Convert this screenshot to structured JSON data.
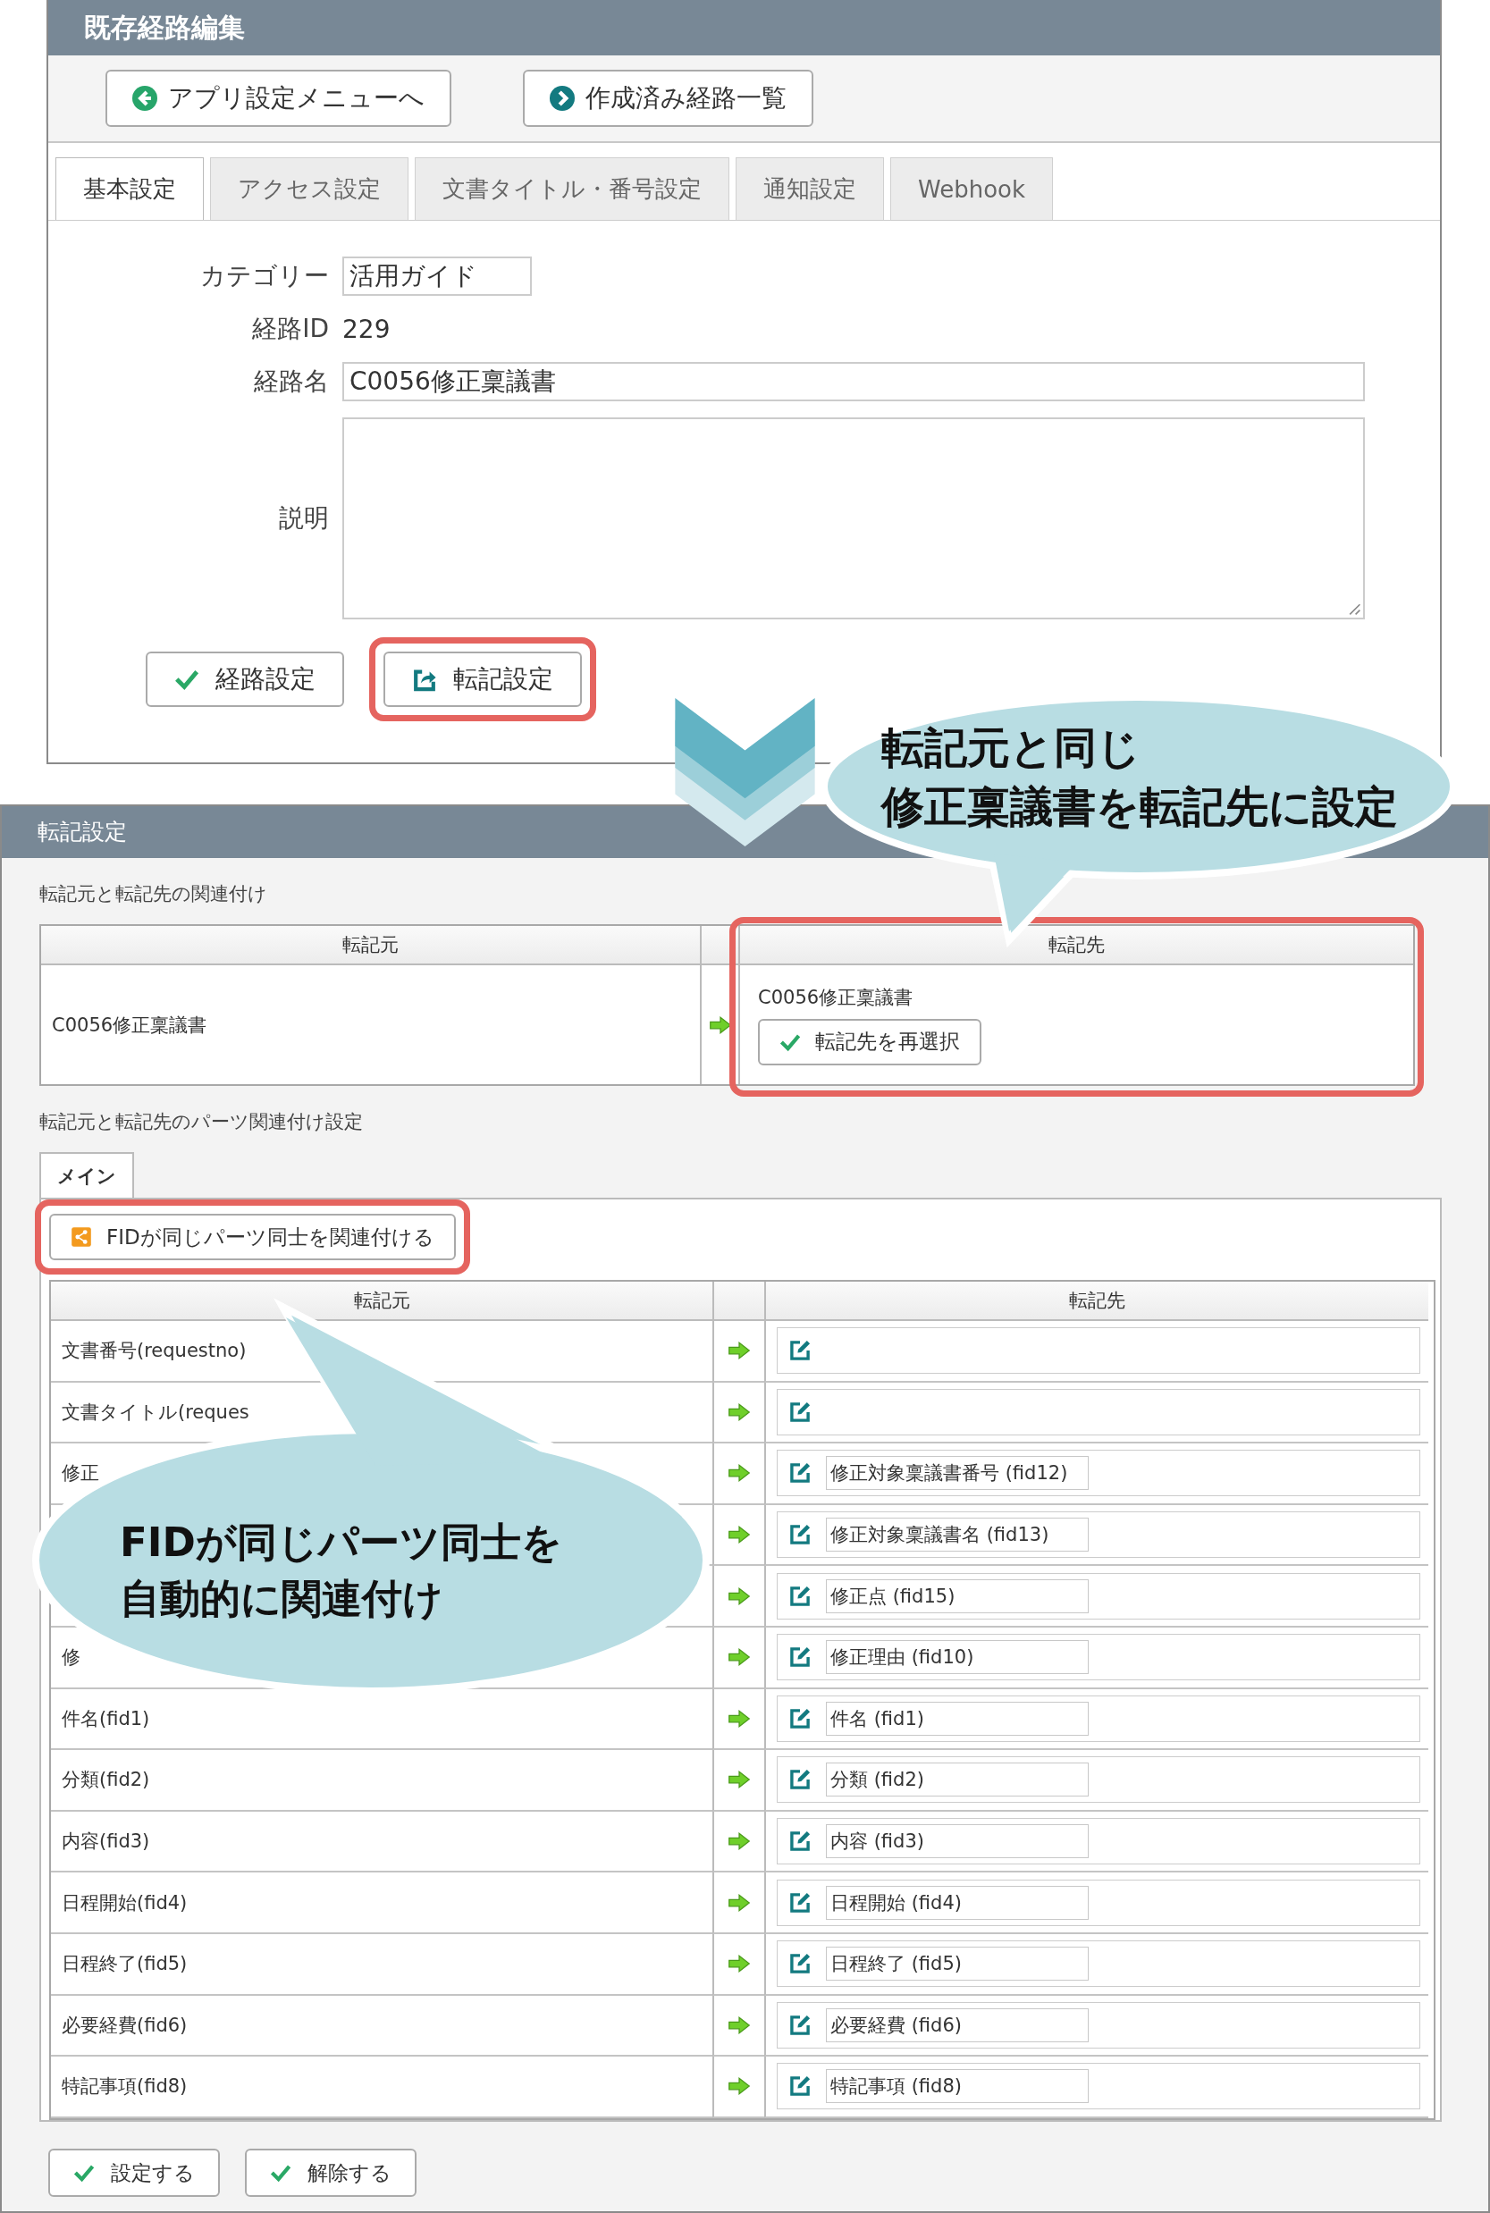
{
  "edit_panel": {
    "title": "既存経路編集",
    "nav_buttons": [
      {
        "label": "アプリ設定メニューへ",
        "kind": "back"
      },
      {
        "label": "作成済み経路一覧",
        "kind": "forward"
      }
    ],
    "tabs": [
      {
        "label": "基本設定",
        "selected": true
      },
      {
        "label": "アクセス設定",
        "selected": false
      },
      {
        "label": "文書タイトル・番号設定",
        "selected": false
      },
      {
        "label": "通知設定",
        "selected": false
      },
      {
        "label": "Webhook",
        "selected": false
      }
    ],
    "form": {
      "category_label": "カテゴリー",
      "category_value": "活用ガイド",
      "id_label": "経路ID",
      "id_value": "229",
      "name_label": "経路名",
      "name_value": "C0056修正稟議書",
      "description_label": "説明"
    },
    "buttons": [
      {
        "label": "経路設定",
        "kind": "check",
        "highlighted": false
      },
      {
        "label": "転記設定",
        "kind": "export",
        "highlighted": true
      }
    ]
  },
  "transfer_panel": {
    "title": "転記設定",
    "section_label": "転記元と転記先の関連付け",
    "mapping_table": {
      "columns": [
        "転記元",
        "転記先"
      ],
      "source": "C0056修正稟議書",
      "target": "C0056修正稟議書",
      "reselect_button": "転記先を再選択",
      "highlighted": true
    },
    "parts_label": "転記元と転記先のパーツ関連付け設定",
    "tabs": [
      {
        "label": "メイン",
        "selected": true
      }
    ],
    "fid_button": {
      "label": "FIDが同じパーツ同士を関連付ける",
      "highlighted": true
    },
    "parts_table": {
      "columns": [
        "転記元",
        "転記先"
      ],
      "rows": [
        {
          "source": "文書番号(requestno)"
        },
        {
          "source": "文書タイトル(reques"
        },
        {
          "source": "修正",
          "target": "修正対象稟議書番号 (fid12)"
        },
        {
          "target": "修正対象稟議書名 (fid13)"
        },
        {
          "target": "修正点 (fid15)"
        },
        {
          "source": "修",
          "target": "修正理由 (fid10)"
        },
        {
          "source": "件名(fid1)",
          "target": "件名 (fid1)"
        },
        {
          "source": "分類(fid2)",
          "target": "分類 (fid2)"
        },
        {
          "source": "内容(fid3)",
          "target": "内容 (fid3)"
        },
        {
          "source": "日程開始(fid4)",
          "target": "日程開始 (fid4)"
        },
        {
          "source": "日程終了(fid5)",
          "target": "日程終了 (fid5)"
        },
        {
          "source": "必要経費(fid6)",
          "target": "必要経費 (fid6)"
        },
        {
          "source": "特記事項(fid8)",
          "target": "特記事項 (fid8)"
        }
      ]
    },
    "buttons": [
      {
        "label": "設定する",
        "kind": "check"
      },
      {
        "label": "解除する",
        "kind": "check"
      }
    ]
  },
  "callouts": [
    {
      "lines": [
        "転記元と同じ",
        "修正稟議書を転記先に設定"
      ]
    },
    {
      "lines": [
        "FIDが同じパーツ同士を",
        "自動的に関連付け"
      ]
    }
  ]
}
